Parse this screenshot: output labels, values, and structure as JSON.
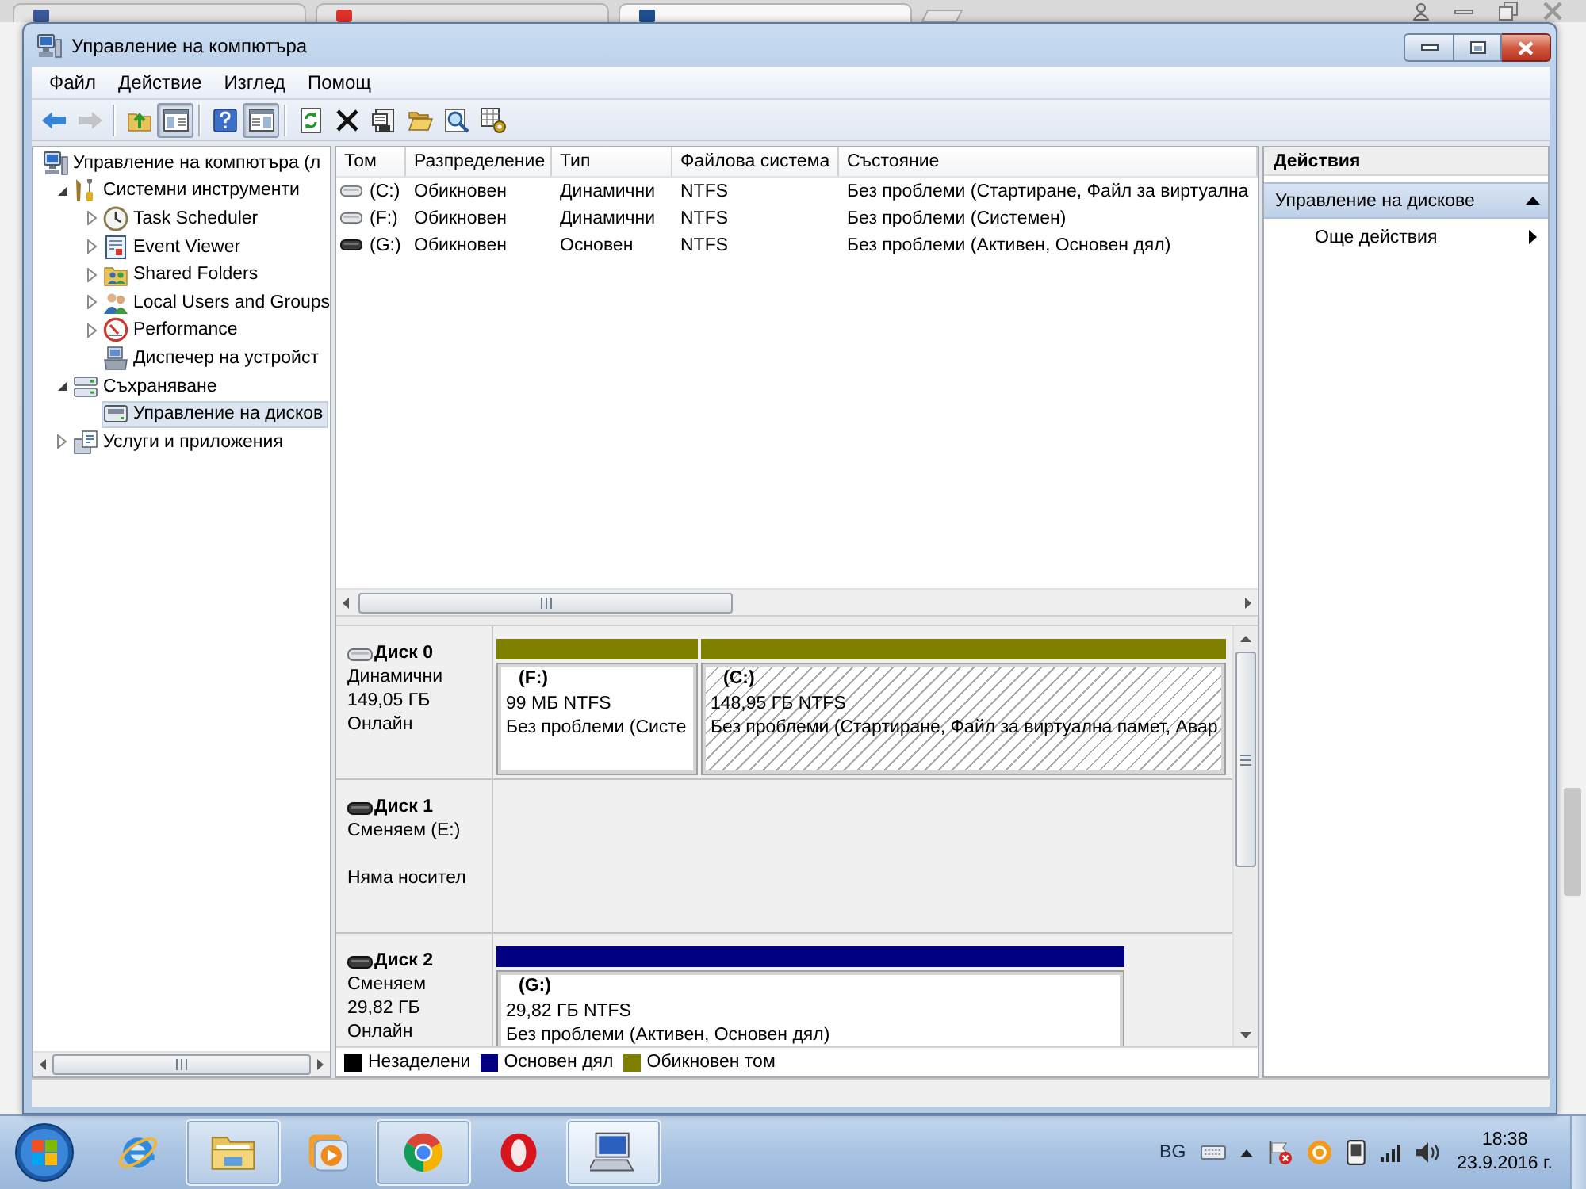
{
  "browser": {
    "tabs": [
      {
        "kind": "social",
        "selected": false
      },
      {
        "kind": "video",
        "selected": false
      },
      {
        "kind": "site",
        "selected": true
      }
    ]
  },
  "window": {
    "title": "Управление на компютъра"
  },
  "menu": [
    "Файл",
    "Действие",
    "Изглед",
    "Помощ"
  ],
  "toolbar": [
    [
      {
        "kind": "back",
        "disabled": false,
        "pressed": false
      },
      {
        "kind": "forward",
        "disabled": true,
        "pressed": false
      }
    ],
    [
      {
        "kind": "up",
        "disabled": false,
        "pressed": false
      },
      {
        "kind": "tree",
        "disabled": false,
        "pressed": true
      }
    ],
    [
      {
        "kind": "help",
        "disabled": false,
        "pressed": false
      },
      {
        "kind": "actionpane",
        "disabled": false,
        "pressed": true
      }
    ],
    [
      {
        "kind": "refresh",
        "disabled": false,
        "pressed": false
      },
      {
        "kind": "delete",
        "disabled": false,
        "pressed": false
      },
      {
        "kind": "properties",
        "disabled": false,
        "pressed": false
      },
      {
        "kind": "open",
        "disabled": false,
        "pressed": false
      },
      {
        "kind": "find",
        "disabled": false,
        "pressed": false
      },
      {
        "kind": "settings",
        "disabled": false,
        "pressed": false
      }
    ]
  ],
  "tree": [
    {
      "label": "Управление на компютъра (л",
      "kind": "computer",
      "expandable": false,
      "selected": false,
      "children": [
        {
          "label": "Системни инструменти",
          "kind": "tools",
          "expandable": true,
          "expanded": true,
          "selected": false,
          "children": [
            {
              "label": "Task Scheduler",
              "kind": "clock",
              "expandable": true,
              "expanded": false,
              "selected": false
            },
            {
              "label": "Event Viewer",
              "kind": "log",
              "expandable": true,
              "expanded": false,
              "selected": false
            },
            {
              "label": "Shared Folders",
              "kind": "shared",
              "expandable": true,
              "expanded": false,
              "selected": false
            },
            {
              "label": "Local Users and Groups",
              "kind": "users",
              "expandable": true,
              "expanded": false,
              "selected": false
            },
            {
              "label": "Performance",
              "kind": "gauge",
              "expandable": true,
              "expanded": false,
              "selected": false
            },
            {
              "label": "Диспечер на устройст",
              "kind": "device",
              "expandable": false,
              "selected": false
            }
          ]
        },
        {
          "label": "Съхраняване",
          "kind": "storage",
          "expandable": true,
          "expanded": true,
          "selected": false,
          "children": [
            {
              "label": "Управление на дисков",
              "kind": "drive",
              "expandable": false,
              "selected": true
            }
          ]
        },
        {
          "label": "Услуги и приложения",
          "kind": "services",
          "expandable": true,
          "expanded": false,
          "selected": false
        }
      ]
    }
  ],
  "table": {
    "columns": [
      "Том",
      "Разпределение",
      "Тип",
      "Файлова система",
      "Състояние"
    ],
    "rows": [
      {
        "kind": "dynamic",
        "cells": [
          "(C:)",
          "Обикновен",
          "Динамични",
          "NTFS",
          "Без проблеми (Стартиране, Файл за виртуална"
        ]
      },
      {
        "kind": "dynamic",
        "cells": [
          "(F:)",
          "Обикновен",
          "Динамични",
          "NTFS",
          "Без проблеми (Системен)"
        ]
      },
      {
        "kind": "basic",
        "cells": [
          "(G:)",
          "Обикновен",
          "Основен",
          "NTFS",
          "Без проблеми (Активен, Основен дял)"
        ]
      }
    ]
  },
  "disks": [
    {
      "kind": "dynamic",
      "name": "Диск 0",
      "type": "Динамични",
      "size": "149,05 ГБ",
      "status": "Онлайн",
      "partitions": [
        {
          "label": "(F:)",
          "size": "99 МБ NTFS",
          "status": "Без проблеми (Систе",
          "color": "#808000",
          "selected": false
        },
        {
          "label": "(C:)",
          "size": "148,95 ГБ NTFS",
          "status": "Без проблеми (Стартиране, Файл за виртуална памет, Авар",
          "color": "#808000",
          "selected": true
        }
      ]
    },
    {
      "kind": "removable",
      "name": "Диск 1",
      "type": "Сменяем (E:)",
      "status": "Няма носител"
    },
    {
      "kind": "removable",
      "name": "Диск 2",
      "type": "Сменяем",
      "size": "29,82 ГБ",
      "status": "Онлайн",
      "partitions": [
        {
          "label": "(G:)",
          "size": "29,82 ГБ NTFS",
          "status": "Без проблеми (Активен, Основен дял)",
          "color": "#000080",
          "selected": false
        }
      ]
    }
  ],
  "legend": [
    {
      "label": "Незаделени",
      "color": "#000000"
    },
    {
      "label": "Основен дял",
      "color": "#000080"
    },
    {
      "label": "Обикновен том",
      "color": "#808000"
    }
  ],
  "actions": {
    "title": "Действия",
    "sections": [
      {
        "label": "Управление на дискове",
        "expanded": true,
        "items": [
          {
            "label": "Още действия",
            "submenu": true
          }
        ]
      }
    ]
  },
  "taskbar": {
    "apps": [
      {
        "kind": "ie",
        "running": false,
        "selected": false
      },
      {
        "kind": "explorer",
        "running": true,
        "selected": false
      },
      {
        "kind": "media",
        "running": false,
        "selected": false
      },
      {
        "kind": "chrome",
        "running": true,
        "selected": false
      },
      {
        "kind": "opera",
        "running": false,
        "selected": false
      },
      {
        "kind": "mmc",
        "running": true,
        "selected": true
      }
    ],
    "tray": {
      "language": "BG",
      "time": "18:38",
      "date": "23.9.2016 г."
    }
  }
}
